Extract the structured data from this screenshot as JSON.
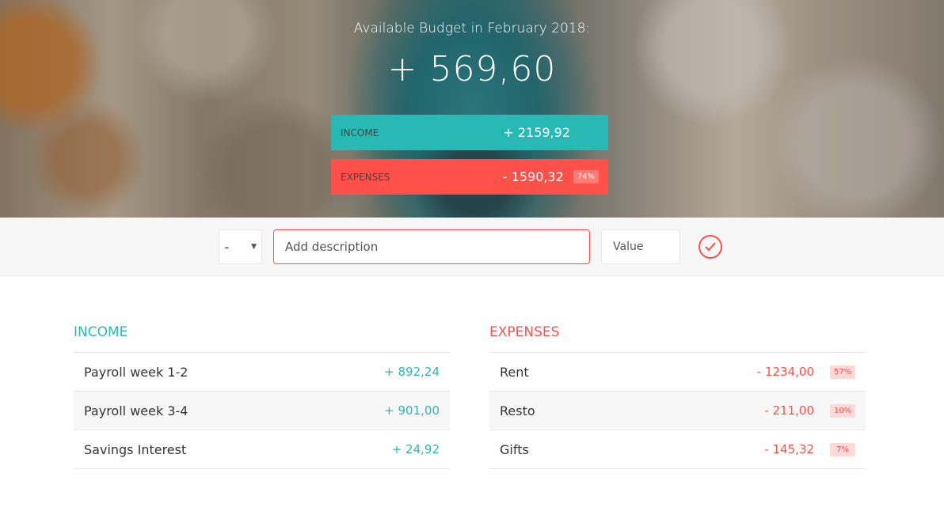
{
  "header": {
    "budget_title": "Available Budget in February 2018:",
    "budget_value": "+ 569,60"
  },
  "summary": {
    "income_label": "INCOME",
    "income_value": "+ 2159,92",
    "expenses_label": "EXPENSES",
    "expenses_value": "- 1590,32",
    "expenses_pct": "74%"
  },
  "add_form": {
    "type_value": "-",
    "description_placeholder": "Add description",
    "value_placeholder": "Value",
    "submit_icon": "checkmark-circle-icon"
  },
  "income": {
    "title": "INCOME",
    "items": [
      {
        "description": "Payroll week 1-2",
        "value": "+ 892,24"
      },
      {
        "description": "Payroll week 3-4",
        "value": "+ 901,00"
      },
      {
        "description": "Savings Interest",
        "value": "+ 24,92"
      }
    ]
  },
  "expenses": {
    "title": "EXPENSES",
    "items": [
      {
        "description": "Rent",
        "value": "- 1234,00",
        "pct": "57%"
      },
      {
        "description": "Resto",
        "value": "- 211,00",
        "pct": "10%"
      },
      {
        "description": "Gifts",
        "value": "- 145,32",
        "pct": "7%"
      }
    ]
  },
  "colors": {
    "income": "#28b9b5",
    "expenses": "#ff5049"
  }
}
